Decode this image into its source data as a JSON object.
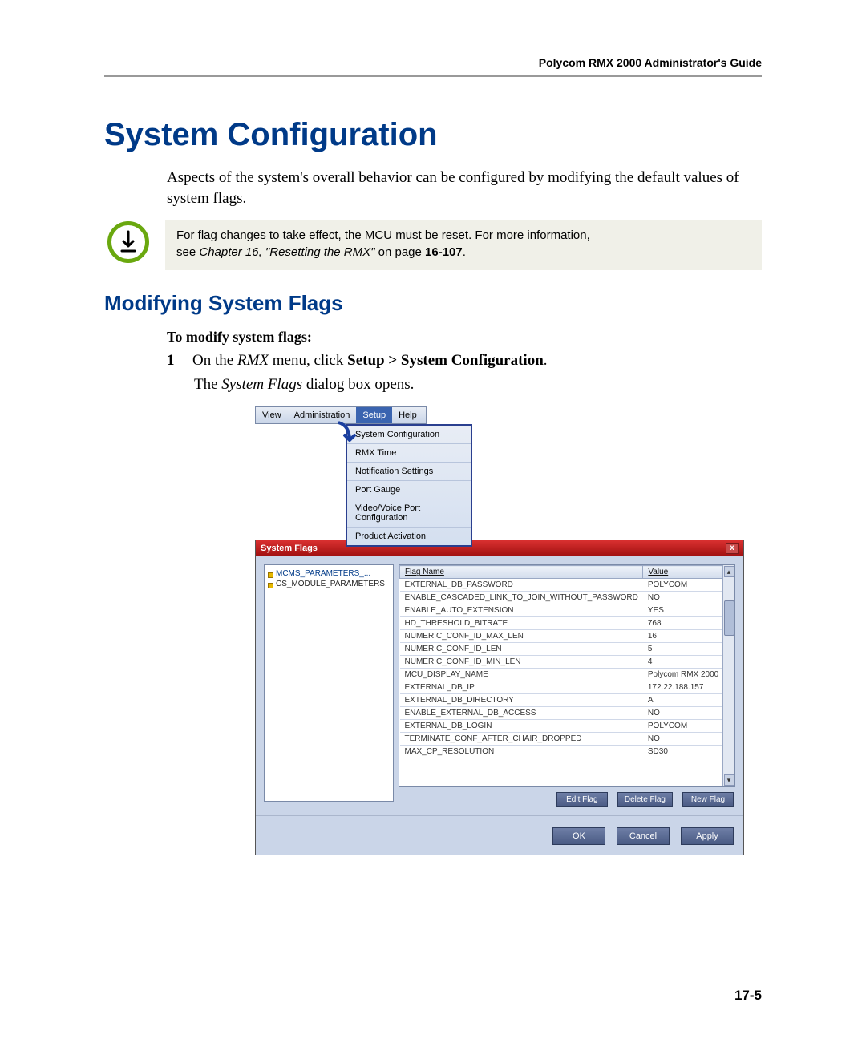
{
  "header": {
    "running_title": "Polycom RMX 2000 Administrator's Guide"
  },
  "headings": {
    "h1": "System Configuration",
    "h2": "Modifying System Flags"
  },
  "paragraphs": {
    "intro": "Aspects of the system's overall behavior can be configured by modifying the default values of system flags."
  },
  "note": {
    "line1": "For flag changes to take effect, the MCU must be reset. For more information,",
    "line2_prefix": "see ",
    "line2_ital": "Chapter 16, \"Resetting the RMX\"",
    "line2_mid": " on page ",
    "page_ref": "16-107",
    "line2_suffix": "."
  },
  "procedure": {
    "title": "To modify system flags:",
    "step1_num": "1",
    "step1_pre": "On the ",
    "step1_i1": "RMX",
    "step1_mid": " menu, click ",
    "step1_b1": "Setup > System Configuration",
    "step1_suffix": ".",
    "result_pre": "The ",
    "result_i": "System Flags",
    "result_post": " dialog box opens."
  },
  "menubar": {
    "items": [
      "View",
      "Administration",
      "Setup",
      "Help"
    ],
    "dropdown": [
      "System Configuration",
      "RMX Time",
      "Notification Settings",
      "Port Gauge",
      "Video/Voice Port Configuration",
      "Product Activation"
    ]
  },
  "dialog": {
    "title": "System Flags",
    "close_x": "x",
    "tree": [
      "MCMS_PARAMETERS_...",
      "CS_MODULE_PARAMETERS"
    ],
    "columns": {
      "flag": "Flag Name",
      "value": "Value"
    },
    "rows": [
      {
        "name": "EXTERNAL_DB_PASSWORD",
        "value": "POLYCOM"
      },
      {
        "name": "ENABLE_CASCADED_LINK_TO_JOIN_WITHOUT_PASSWORD",
        "value": "NO"
      },
      {
        "name": "ENABLE_AUTO_EXTENSION",
        "value": "YES"
      },
      {
        "name": "HD_THRESHOLD_BITRATE",
        "value": "768"
      },
      {
        "name": "NUMERIC_CONF_ID_MAX_LEN",
        "value": "16"
      },
      {
        "name": "NUMERIC_CONF_ID_LEN",
        "value": "5"
      },
      {
        "name": "NUMERIC_CONF_ID_MIN_LEN",
        "value": "4"
      },
      {
        "name": "MCU_DISPLAY_NAME",
        "value": "Polycom RMX 2000"
      },
      {
        "name": "EXTERNAL_DB_IP",
        "value": "172.22.188.157"
      },
      {
        "name": "EXTERNAL_DB_DIRECTORY",
        "value": "A"
      },
      {
        "name": "ENABLE_EXTERNAL_DB_ACCESS",
        "value": "NO"
      },
      {
        "name": "EXTERNAL_DB_LOGIN",
        "value": "POLYCOM"
      },
      {
        "name": "TERMINATE_CONF_AFTER_CHAIR_DROPPED",
        "value": "NO"
      },
      {
        "name": "MAX_CP_RESOLUTION",
        "value": "SD30"
      }
    ],
    "buttons_row": {
      "edit": "Edit Flag",
      "delete": "Delete Flag",
      "new": "New Flag"
    },
    "footer": {
      "ok": "OK",
      "cancel": "Cancel",
      "apply": "Apply"
    }
  },
  "page_number": "17-5"
}
